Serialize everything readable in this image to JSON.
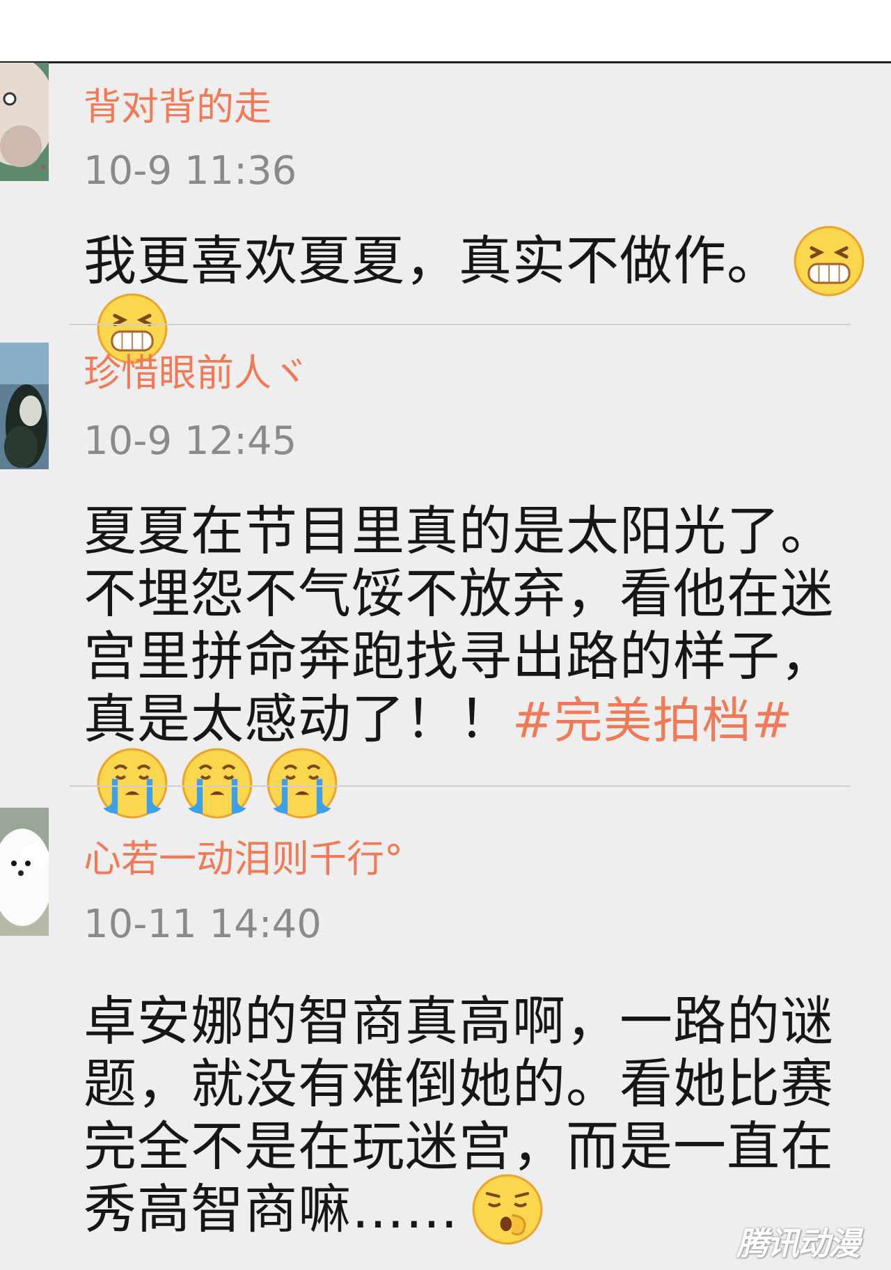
{
  "colors": {
    "background": "#efeeee",
    "username": "#f07a57",
    "timestamp": "#8a8a8a",
    "hashtag": "#f07a57",
    "body_text": "#161616"
  },
  "comments": [
    {
      "username": "背对背的走",
      "time": "10-9 11:36",
      "text": "我更喜欢夏夏，真实不做作。",
      "emojis": [
        "grin-icon",
        "grin-icon"
      ]
    },
    {
      "username": "珍惜眼前人ヾ",
      "time": "10-9 12:45",
      "text": "夏夏在节目里真的是太阳光了。不埋怨不气馁不放弃，看他在迷宫里拼命奔跑找寻出路的样子，真是太感动了！！",
      "hashtag": "#完美拍档#",
      "emojis": [
        "crying-icon",
        "crying-icon",
        "crying-icon"
      ]
    },
    {
      "username": "心若一动泪则千行°",
      "time": "10-11 14:40",
      "text": "卓安娜的智商真高啊，一路的谜题，就没有难倒她的。看她比赛完全不是在玩迷宫，而是一直在秀高智商嘛……",
      "emojis": [
        "sleepy-icon"
      ]
    }
  ],
  "watermark": "腾讯动漫"
}
